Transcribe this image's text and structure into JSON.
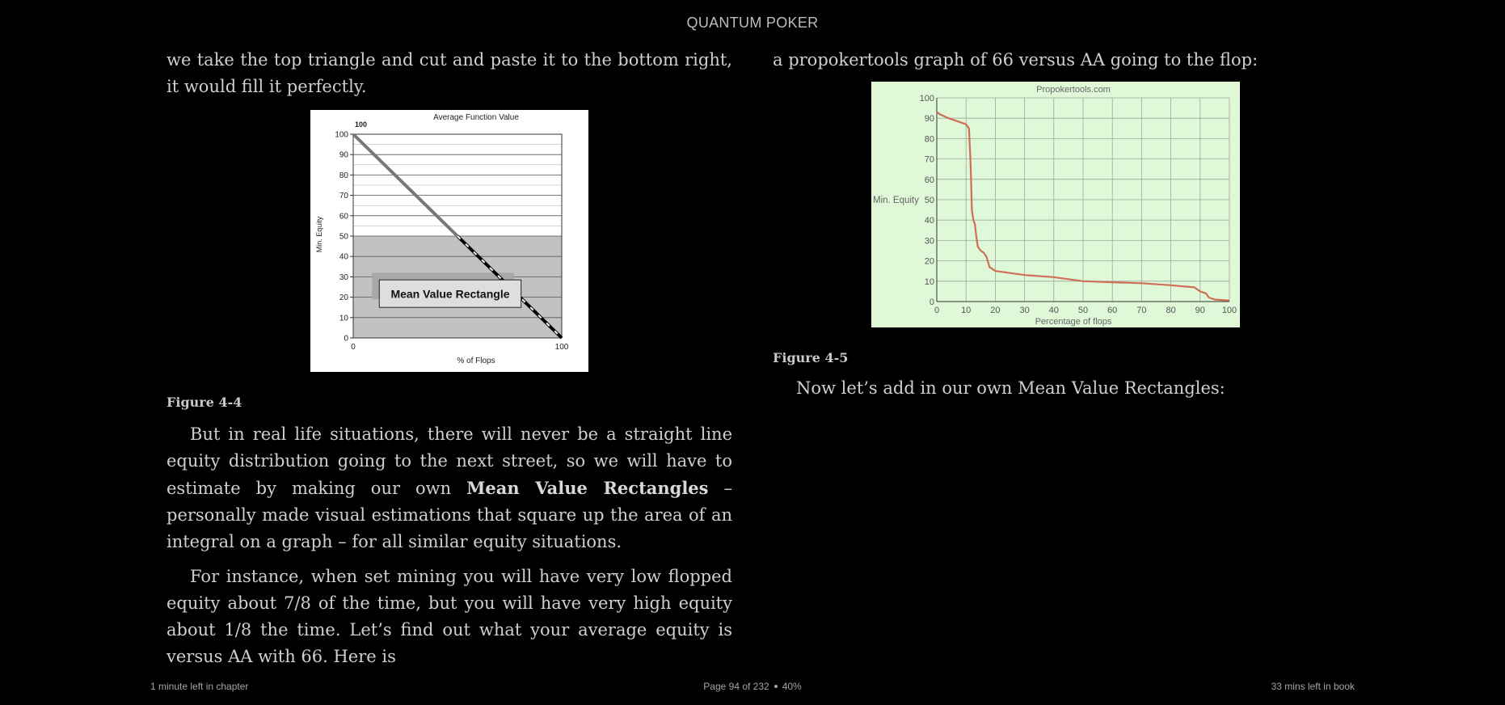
{
  "header": {
    "title": "QUANTUM POKER"
  },
  "left_column": {
    "para1": "we take the top triangle and cut and paste it to the bottom right, it would fill it perfectly.",
    "figure_caption": "Figure 4-4",
    "para2_a": "But in real life situations, there will never be a straight line equity distribution going to the next street, so we will have to estimate by making our own ",
    "para2_bold": "Mean Value Rectangles",
    "para2_b": " – personally made visual estimations that square up the area of an integral on a graph – for all similar equity situations.",
    "para3": "For instance, when set mining you will have very low flopped equity about 7/8 of the time, but you will have very high equity about 1/8 the time. Let’s find out what your average equity is versus AA with 66. Here is"
  },
  "right_column": {
    "para1": "a propokertools graph of 66 versus AA going to the flop:",
    "figure_caption": "Figure 4-5",
    "para2": "Now let’s add in our own Mean Value Rectangles:"
  },
  "chart_data": [
    {
      "type": "line",
      "title": "Average Function Value",
      "xlabel": "% of Flops",
      "ylabel": "Min. Equity",
      "x_ticks": [
        "0",
        "100"
      ],
      "y_ticks": [
        "0",
        "10",
        "20",
        "30",
        "40",
        "50",
        "60",
        "70",
        "80",
        "90",
        "100"
      ],
      "xlim": [
        0,
        100
      ],
      "ylim": [
        0,
        100
      ],
      "point_label": "100",
      "annotation": "Mean Value Rectangle",
      "series": [
        {
          "x": [
            0,
            100
          ],
          "y": [
            100,
            0
          ]
        }
      ],
      "mean_value": 50
    },
    {
      "type": "line",
      "title": "Propokertools.com",
      "xlabel": "Percentage of flops",
      "ylabel": "Min. Equity",
      "x_ticks": [
        "0",
        "10",
        "20",
        "30",
        "40",
        "50",
        "60",
        "70",
        "80",
        "90",
        "100"
      ],
      "y_ticks": [
        "0",
        "10",
        "20",
        "30",
        "40",
        "50",
        "60",
        "70",
        "80",
        "90",
        "100"
      ],
      "xlim": [
        0,
        100
      ],
      "ylim": [
        0,
        100
      ],
      "grid": true,
      "series": [
        {
          "x": [
            0,
            1,
            4,
            8,
            10,
            11,
            11.5,
            11.7,
            12,
            12.5,
            13,
            13.5,
            14,
            15,
            16,
            17,
            18,
            20,
            25,
            30,
            40,
            45,
            50,
            60,
            70,
            80,
            88,
            90,
            92,
            93,
            95,
            100
          ],
          "y": [
            93,
            92,
            90,
            88,
            87,
            85,
            70,
            60,
            45,
            40,
            38,
            32,
            27,
            25,
            24,
            22,
            17,
            15,
            14,
            13,
            12,
            11,
            10,
            9.5,
            9,
            8,
            7,
            5,
            4,
            2,
            1,
            0.5
          ]
        }
      ]
    }
  ],
  "footer": {
    "left": "1 minute left in chapter",
    "page": "Page 94 of 232",
    "percent": "40%",
    "right": "33 mins left in book"
  },
  "colors": {
    "background": "#000000",
    "text": "#cfcfcf",
    "fig2_bg": "#dff8d8",
    "fig2_line": "#cf6e57"
  }
}
